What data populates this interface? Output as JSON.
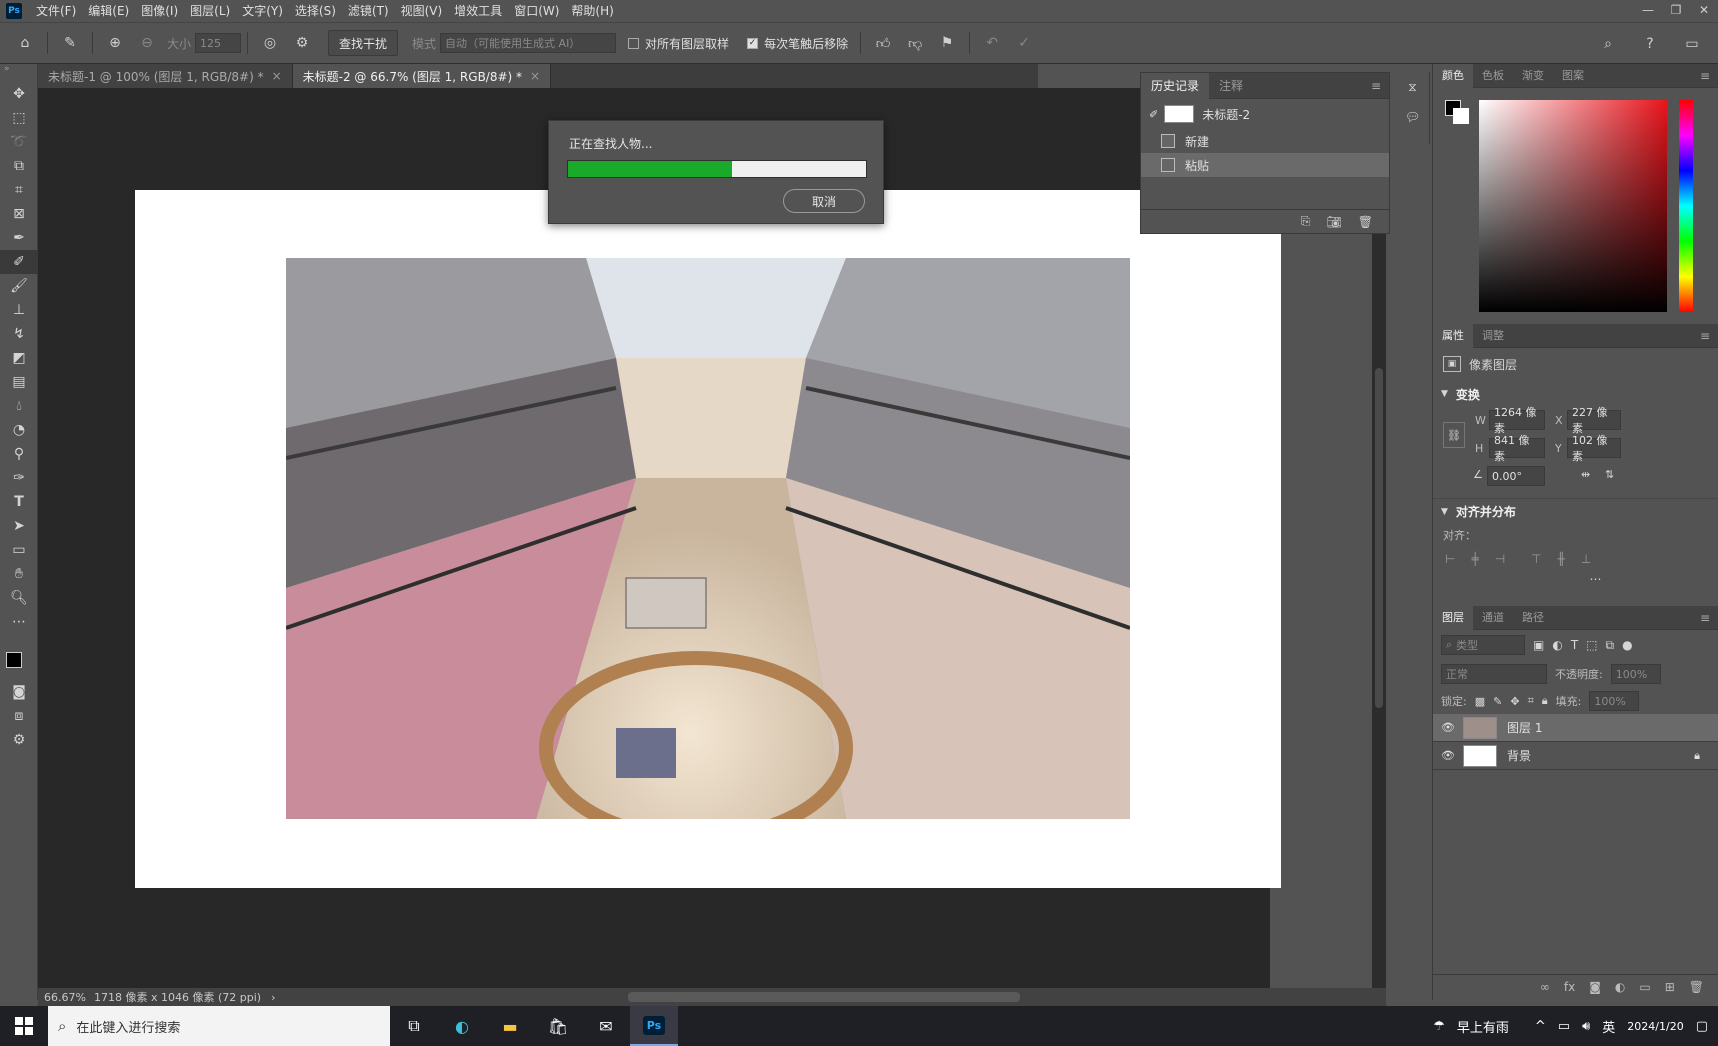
{
  "menubar": {
    "logo": "Ps",
    "items": [
      "文件(F)",
      "编辑(E)",
      "图像(I)",
      "图层(L)",
      "文字(Y)",
      "选择(S)",
      "滤镜(T)",
      "视图(V)",
      "增效工具",
      "窗口(W)",
      "帮助(H)"
    ]
  },
  "optionsbar": {
    "size_label": "大小",
    "size_value": "125",
    "find_btn": "查找干扰",
    "mode_label": "模式",
    "mode_value": "自动（可能使用生成式 AI）",
    "sample_all_label": "对所有图层取样",
    "remove_each_label": "每次笔触后移除"
  },
  "tabs": [
    {
      "label": "未标题-1 @ 100% (图层 1, RGB/8#) *",
      "active": false
    },
    {
      "label": "未标题-2 @ 66.7% (图层 1, RGB/8#) *",
      "active": true
    }
  ],
  "dialog": {
    "message": "正在查找人物...",
    "progress": 0.55,
    "cancel": "取消"
  },
  "history": {
    "tabs": [
      "历史记录",
      "注释"
    ],
    "rows": [
      {
        "label": "未标题-2",
        "kind": "snapshot"
      },
      {
        "label": "新建",
        "kind": "step"
      },
      {
        "label": "粘贴",
        "kind": "step",
        "selected": true
      }
    ]
  },
  "color_panel": {
    "tabs": [
      "颜色",
      "色板",
      "渐变",
      "图案"
    ]
  },
  "properties": {
    "tabs": [
      "属性",
      "调整"
    ],
    "layer_type": "像素图层",
    "transform_title": "变换",
    "w_label": "W",
    "w_value": "1264 像素",
    "x_label": "X",
    "x_value": "227 像素",
    "h_label": "H",
    "h_value": "841 像素",
    "y_label": "Y",
    "y_value": "102 像素",
    "angle_value": "0.00°",
    "align_title": "对齐并分布",
    "align_label": "对齐："
  },
  "layers": {
    "tabs": [
      "图层",
      "通道",
      "路径"
    ],
    "filter_placeholder": "类型",
    "blend_mode": "正常",
    "opacity_label": "不透明度:",
    "opacity_value": "100%",
    "lock_label": "锁定:",
    "fill_label": "填充:",
    "fill_value": "100%",
    "rows": [
      {
        "name": "图层 1",
        "selected": true
      },
      {
        "name": "背景",
        "locked": true
      }
    ]
  },
  "status": {
    "zoom": "66.67%",
    "info": "1718 像素 x 1046 像素 (72 ppi)"
  },
  "taskbar": {
    "search_placeholder": "在此键入进行搜索",
    "weather": "早上有雨",
    "lang": "英",
    "date": "2024/1/20"
  }
}
